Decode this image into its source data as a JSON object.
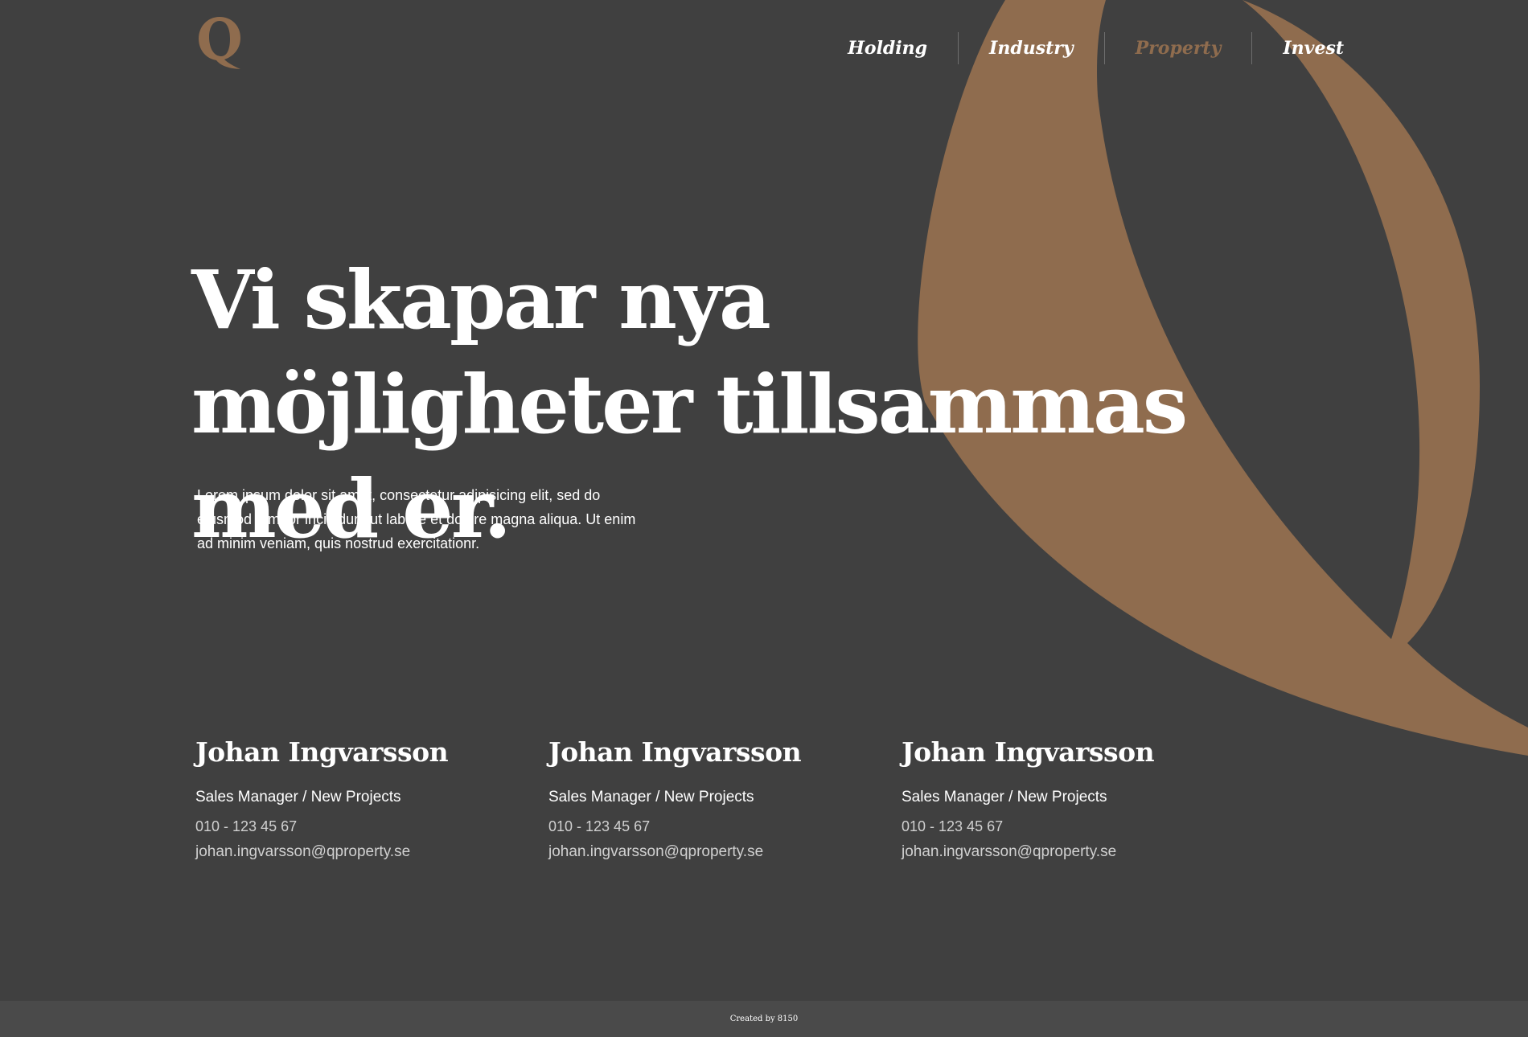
{
  "brand": {
    "logo_letter": "Q",
    "accent_color": "#8f6c4e",
    "background_color": "#404040"
  },
  "nav": {
    "items": [
      {
        "label": "Holding",
        "active": false
      },
      {
        "label": "Industry",
        "active": false
      },
      {
        "label": "Property",
        "active": true
      },
      {
        "label": "Invest",
        "active": false
      }
    ]
  },
  "hero": {
    "title": "Vi skapar nya möjligheter tillsammas med er.",
    "text": "Lorem ipsum dolor sit amet, consectetur adipisicing elit, sed do eiusmod tempor incididunt ut labore et dolore magna aliqua. Ut enim ad minim veniam, quis nostrud exercitationr."
  },
  "contacts": [
    {
      "name": "Johan Ingvarsson",
      "role": "Sales Manager / New Projects",
      "phone": "010 - 123 45 67",
      "email": "johan.ingvarsson@qproperty.se"
    },
    {
      "name": "Johan Ingvarsson",
      "role": "Sales Manager / New Projects",
      "phone": "010 - 123 45 67",
      "email": "johan.ingvarsson@qproperty.se"
    },
    {
      "name": "Johan Ingvarsson",
      "role": "Sales Manager / New Projects",
      "phone": "010 - 123 45 67",
      "email": "johan.ingvarsson@qproperty.se"
    }
  ],
  "footer": {
    "credit": "Created by 8150"
  }
}
